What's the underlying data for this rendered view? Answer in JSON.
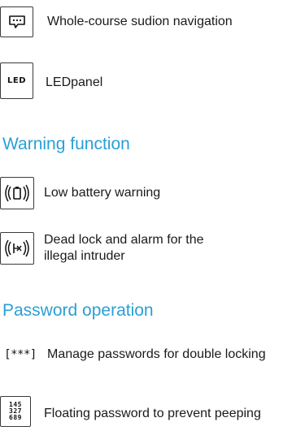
{
  "features_top": [
    {
      "label": "Whole-course sudion navigation",
      "icon": "chat-bubble-icon"
    },
    {
      "label": "LEDpanel",
      "icon": "led-icon",
      "icon_text": "LED"
    }
  ],
  "warning": {
    "title": "Warning function",
    "items": [
      {
        "label": "Low battery warning",
        "icon": "battery-signal-icon"
      },
      {
        "label_line1": "Dead lock and alarm for the",
        "label_line2": "illegal intruder",
        "icon": "alarm-intruder-icon"
      }
    ]
  },
  "password": {
    "title": "Password operation",
    "items": [
      {
        "label": "Manage passwords for double locking",
        "icon": "password-stars-icon",
        "icon_text": "[***]"
      },
      {
        "label": "Floating password to prevent peeping",
        "icon": "keypad-digits-icon",
        "digits_row1": "145",
        "digits_row2": "327",
        "digits_row3": "689"
      }
    ]
  },
  "colors": {
    "heading": "#2a9fd8",
    "text": "#1a1a1a",
    "icon_border": "#3a3a3a"
  }
}
